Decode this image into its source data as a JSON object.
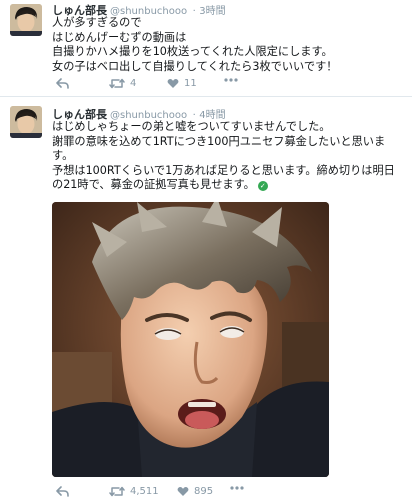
{
  "tweets": [
    {
      "name": "しゅん部長",
      "handle": "@shunbuchooo",
      "separator": "·",
      "time": "3時間",
      "lines": [
        "人が多すぎるので",
        "はじめんげーむずの動画は",
        "自撮りかハメ撮りを10枚送ってくれた人限定にします。",
        "女の子はベロ出して自撮りしてくれたら3枚でいいです！"
      ],
      "retweets": "4",
      "likes": "11"
    },
    {
      "name": "しゅん部長",
      "handle": "@shunbuchooo",
      "separator": "·",
      "time": "4時間",
      "lines": [
        "はじめしゃちょーの弟と嘘をついてすいませんでした。",
        "謝罪の意味を込めて1RTにつき100円ユニセフ募金したいと思いま",
        "す。",
        "予想は100RTくらいで1万あれば足りると思います。締め切りは明日",
        "の21時で、募金の証拠写真も見せます。"
      ],
      "retweets": "4,511",
      "likes": "895"
    }
  ],
  "icons": {
    "reply": "reply-icon",
    "retweet": "retweet-icon",
    "like": "heart-icon",
    "more": "more-icon",
    "check": "check-icon"
  },
  "colors": {
    "muted": "#8899a6",
    "text": "#14171a",
    "check_green": "#34a853",
    "divider": "#e1e8ed"
  }
}
